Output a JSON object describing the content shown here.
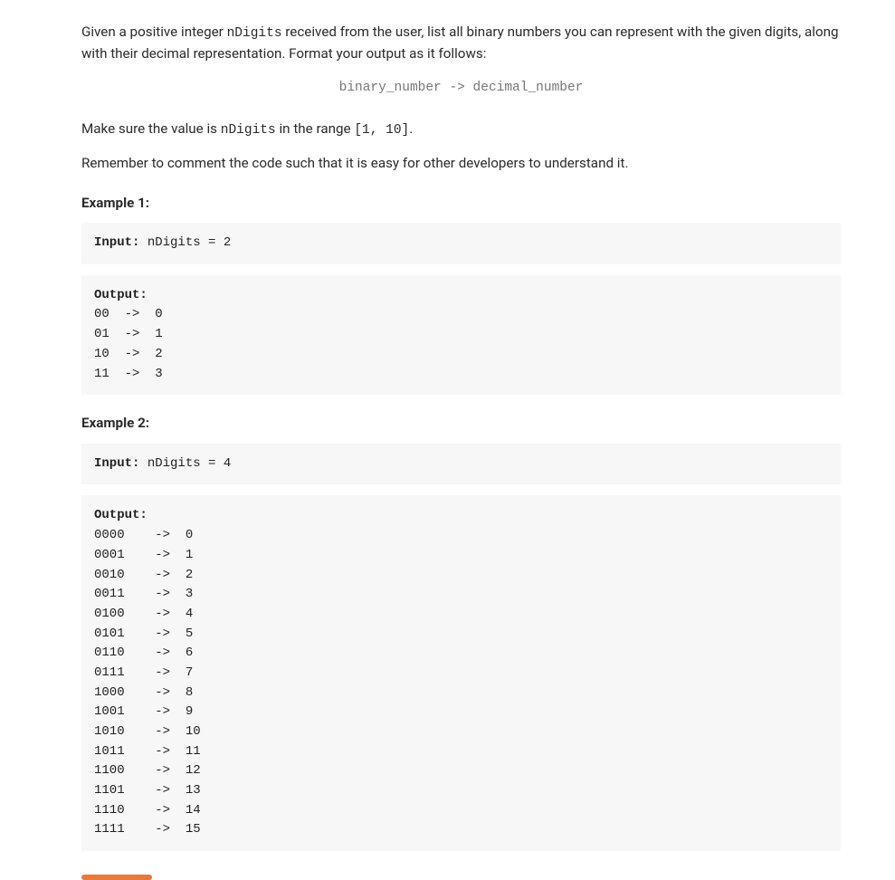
{
  "intro": {
    "para1_a": "Given a positive integer ",
    "para1_code": "nDigits",
    "para1_b": " received from the user, list all binary numbers you can represent with the given digits, along with their decimal representation. Format your output as it follows:",
    "format_line": "binary_number -> decimal_number",
    "para2_a": "Make sure the value is ",
    "para2_code": "nDigits",
    "para2_b": " in the range ",
    "para2_range": "[1, 10]",
    "para2_c": ".",
    "para3": "Remember to comment the code such that it is easy for other developers to understand it."
  },
  "example1": {
    "heading": "Example 1:",
    "input_label": "Input:",
    "input_rest": " nDigits = 2",
    "output_label": "Output:",
    "rows": [
      "00  ->  0",
      "01  ->  1",
      "10  ->  2",
      "11  ->  3"
    ]
  },
  "example2": {
    "heading": "Example 2:",
    "input_label": "Input:",
    "input_rest": " nDigits = 4",
    "output_label": "Output:",
    "rows": [
      "0000    ->  0",
      "0001    ->  1",
      "0010    ->  2",
      "0011    ->  3",
      "0100    ->  4",
      "0101    ->  5",
      "0110    ->  6",
      "0111    ->  7",
      "1000    ->  8",
      "1001    ->  9",
      "1010    ->  10",
      "1011    ->  11",
      "1100    ->  12",
      "1101    ->  13",
      "1110    ->  14",
      "1111    ->  15"
    ]
  }
}
